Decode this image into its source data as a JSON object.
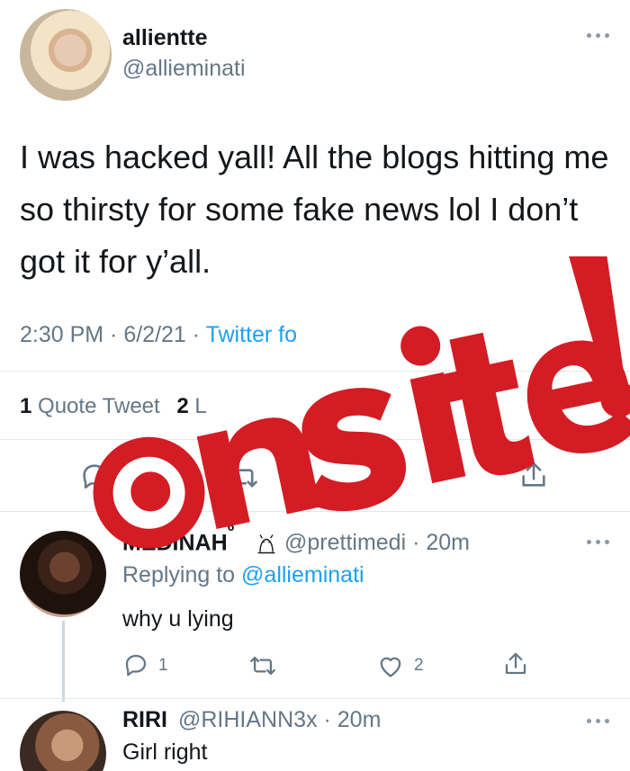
{
  "main_tweet": {
    "name": "allientte",
    "handle": "@allieminati",
    "text": "I was hacked yall! All the blogs hitting me so thirsty for some fake news lol I don’t got it for y’all.",
    "time_date": "2:30 PM · 6/2/21 · ",
    "source": "Twitter fo",
    "quote_count": "1",
    "quote_label": "Quote Tweet",
    "likes_fragment": "2",
    "likes_label_fragment": "L"
  },
  "watermark": {
    "text": "onsite!",
    "color": "#d41c24"
  },
  "replies": [
    {
      "name": "MEDINAH",
      "name_sup": "6",
      "handle_time": "@prettimedi · 20m",
      "replying_prefix": "Replying to ",
      "replying_handle": "@allieminati",
      "text": "why u lying",
      "reply_count": "1",
      "like_count": "2"
    },
    {
      "name": "RIRI",
      "handle_time": "@RIHIANN3x · 20m",
      "text": "Girl right"
    }
  ],
  "icons": {
    "reply": "reply-icon",
    "retweet": "retweet-icon",
    "like": "heart-icon",
    "share": "share-icon",
    "more": "more-icon",
    "owl": "owl-icon"
  },
  "colors": {
    "link_blue": "#1da1f2",
    "secondary_gray": "#657786",
    "icon_gray": "#657786",
    "text_dark": "#14171a"
  }
}
